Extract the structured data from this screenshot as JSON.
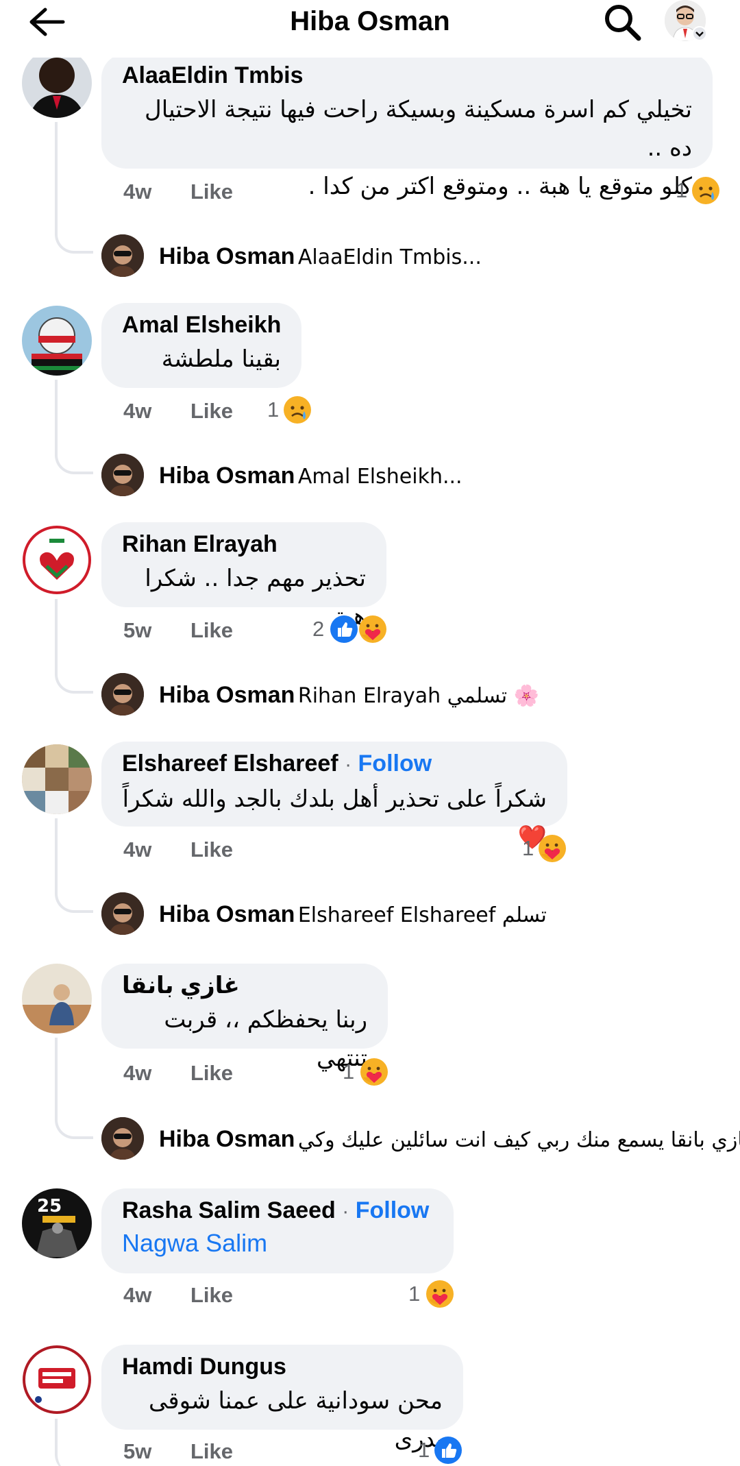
{
  "header": {
    "title": "Hiba Osman",
    "back_icon": "arrow-left-icon",
    "search_icon": "search-icon"
  },
  "colors": {
    "accent": "#1877f2",
    "bubble": "#f0f2f5",
    "meta": "#65676b",
    "thread_line": "#e4e6eb"
  },
  "comments": [
    {
      "author": "AlaaEldin Tmbis",
      "follow": "",
      "text_lines": [
        "تخيلي كم اسرة مسكينة وبسيكة راحت فيها نتيجة الاحتيال ده ..",
        "كلو متوقع يا هبة .. ومتوقع اكتر من كدا ."
      ],
      "time": "4w",
      "like": "Like",
      "reaction_count": "1",
      "reactions": [
        "sad"
      ],
      "reply": {
        "author": "Hiba Osman",
        "text": "AlaaEldin Tmbis..."
      }
    },
    {
      "author": "Amal Elsheikh",
      "follow": "",
      "text_lines": [
        "بقينا ملطشة"
      ],
      "time": "4w",
      "like": "Like",
      "reaction_count": "1",
      "reactions": [
        "sad"
      ],
      "reply": {
        "author": "Hiba Osman",
        "text": "Amal Elsheikh..."
      }
    },
    {
      "author": "Rihan Elrayah",
      "follow": "",
      "text_lines": [
        "تحذير مهم جدا .. شكرا هبة"
      ],
      "time": "5w",
      "like": "Like",
      "reaction_count": "2",
      "reactions": [
        "like",
        "care"
      ],
      "reply": {
        "author": "Hiba Osman",
        "text": "Rihan Elrayah تسلمي 🌸"
      }
    },
    {
      "author": "Elshareef Elshareef",
      "follow": "Follow",
      "follow_sep": "·",
      "text_lines": [
        "شكراً على تحذير أهل بلدك بالجد والله شكراً ❤️"
      ],
      "time": "4w",
      "like": "Like",
      "reaction_count": "1",
      "reactions": [
        "care"
      ],
      "reply": {
        "author": "Hiba Osman",
        "text": "Elshareef Elshareef تسلم"
      }
    },
    {
      "author": "غازي بانقا",
      "follow": "",
      "text_lines": [
        "ربنا يحفظكم ،، قربت تنتهي"
      ],
      "time": "4w",
      "like": "Like",
      "reaction_count": "1",
      "reactions": [
        "care"
      ],
      "reply": {
        "author": "Hiba Osman",
        "text": "غازي بانقا يسمع منك ربي كيف انت سائلين عليك وكي..."
      }
    },
    {
      "author": "Rasha Salim Saeed",
      "follow": "Follow",
      "follow_sep": "·",
      "tag": "Nagwa Salim",
      "time": "4w",
      "like": "Like",
      "reaction_count": "1",
      "reactions": [
        "care"
      ]
    },
    {
      "author": "Hamdi Dungus",
      "follow": "",
      "text_lines": [
        "محن سودانية على عمنا شوقى بدرى"
      ],
      "time": "5w",
      "like": "Like",
      "reaction_count": "1",
      "reactions": [
        "like"
      ]
    }
  ]
}
